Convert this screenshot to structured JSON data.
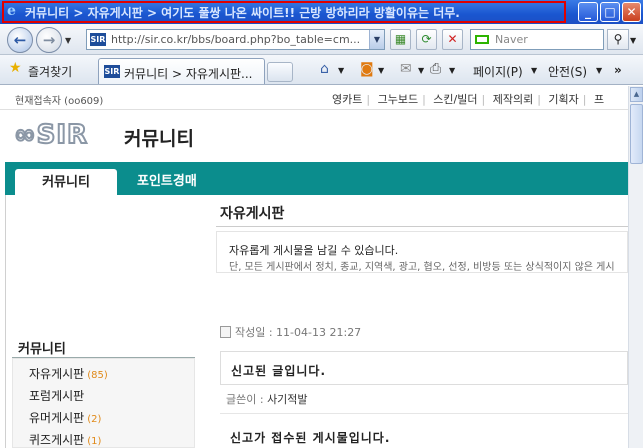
{
  "window": {
    "title": "커뮤니티 > 자유게시판 > 여기도 풀쌍 나온 싸이트!! 근방 방하리라 방활이유는 더무."
  },
  "toolbar": {
    "address": "http://sir.co.kr/bbs/board.php?bo_table=cm...",
    "favicon_text": "SIR",
    "search_placeholder": "Naver"
  },
  "favorites": {
    "label": "즐겨찾기",
    "tab_label": "커뮤니티 > 자유게시판...",
    "commands": {
      "page": "페이지(P)",
      "safety": "안전(S)"
    }
  },
  "site": {
    "connect_count": "현재접속자 (oo609)",
    "topnav": [
      "영카트",
      "그누보드",
      "스킨/빌더",
      "제작의뢰",
      "기획자",
      "프"
    ],
    "logo": "∞SIR",
    "title": "커뮤니티",
    "tabs": [
      "커뮤니티",
      "포인트경매"
    ]
  },
  "board": {
    "title": "자유게시판",
    "desc_line1": "자유롭게 게시물을 남길 수 있습니다.",
    "desc_line2": "단, 모든 게시판에서 정치, 종교, 지역색, 광고, 협오, 선정, 비방등 또는 상식적이지 않은 게시"
  },
  "sidebar": {
    "title": "커뮤니티",
    "items": [
      {
        "label": "자유게시판",
        "count": "(85)"
      },
      {
        "label": "포럼게시판",
        "count": ""
      },
      {
        "label": "유머게시판",
        "count": "(2)"
      },
      {
        "label": "퀴즈게시판",
        "count": "(1)"
      }
    ]
  },
  "post": {
    "meta_label": "작성일 : 11-04-13 21:27",
    "title": "신고된 글입니다.",
    "author_label": "글쓴이 : ",
    "author": "사기적발",
    "body": "신고가 접수된 게시물입니다."
  }
}
